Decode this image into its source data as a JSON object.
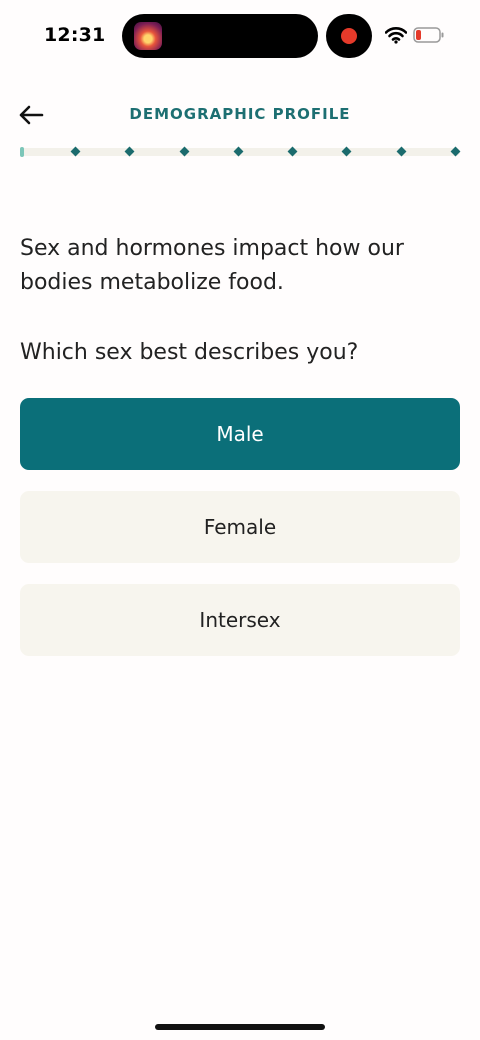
{
  "status_bar": {
    "time": "12:31",
    "icons": [
      "app-thumbnail-icon",
      "record-icon",
      "wifi-icon",
      "battery-icon"
    ]
  },
  "header": {
    "back_icon": "arrow-left-icon",
    "title": "DEMOGRAPHIC PROFILE"
  },
  "progress": {
    "total_steps": 8,
    "current_step": 1
  },
  "content": {
    "intro": "Sex and hormones impact how our bodies metabolize food.",
    "question": "Which sex best describes you?"
  },
  "options": [
    {
      "label": "Male",
      "selected": true
    },
    {
      "label": "Female",
      "selected": false
    },
    {
      "label": "Intersex",
      "selected": false
    }
  ],
  "colors": {
    "accent": "#0b6f79",
    "title": "#1d6f72",
    "option_bg": "#f7f5ee",
    "track": "#f3f1ea",
    "record": "#e53a2a"
  }
}
